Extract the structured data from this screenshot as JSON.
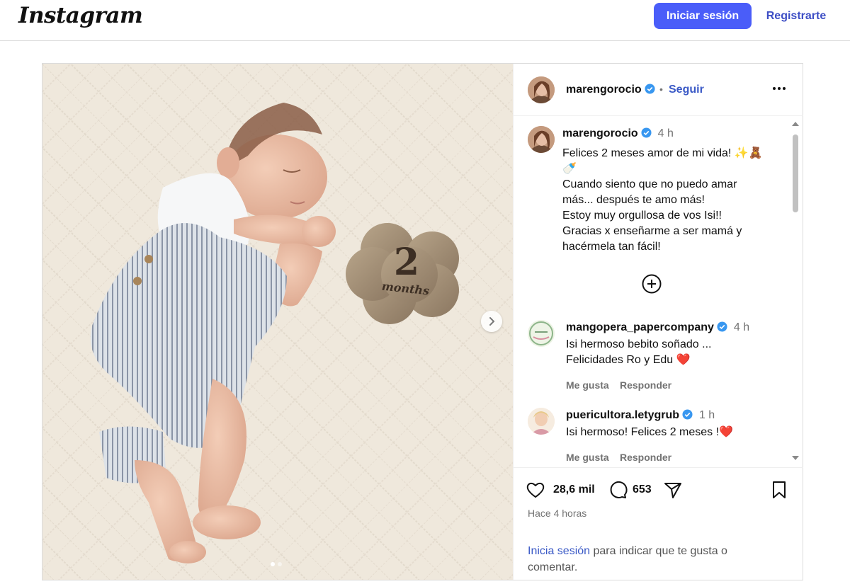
{
  "header": {
    "logo": "Instagram",
    "login_label": "Iniciar sesión",
    "register_label": "Registrarte"
  },
  "post": {
    "username": "marengorocio",
    "follow_label": "Seguir",
    "separator": "•",
    "caption": {
      "username": "marengorocio",
      "time": "4 h",
      "lines": [
        "Felices 2 meses amor de mi vida! ✨🧸",
        "🍼",
        "Cuando siento que no puedo amar",
        "más... después te amo más!",
        "Estoy muy orgullosa de vos Isi!!",
        "Gracias x enseñarme a ser mamá y",
        "hacérmela tan fácil!"
      ]
    },
    "comments": [
      {
        "username": "mangopera_papercompany",
        "time": "4 h",
        "line1": "Isi hermoso bebito soñado ...",
        "line2": "Felicidades Ro y Edu ❤️",
        "like_label": "Me gusta",
        "reply_label": "Responder"
      },
      {
        "username": "puericultora.letygrub",
        "time": "1 h",
        "line1": "Isi hermoso! Felices 2 meses !❤️",
        "like_label": "Me gusta",
        "reply_label": "Responder"
      }
    ],
    "likes": "28,6 mil",
    "comments_count": "653",
    "posted": "Hace 4 horas",
    "login_prompt_link": "Inicia sesión",
    "login_prompt_rest": " para indicar que te gusta o comentar.",
    "media": {
      "plaque_number": "2",
      "plaque_word": "months",
      "slide_count": 2,
      "active_slide": 1
    }
  },
  "colors": {
    "primary_button": "#4a5df9",
    "link": "#3a59c6",
    "verified": "#3897f0",
    "heart": "#e0245e"
  }
}
